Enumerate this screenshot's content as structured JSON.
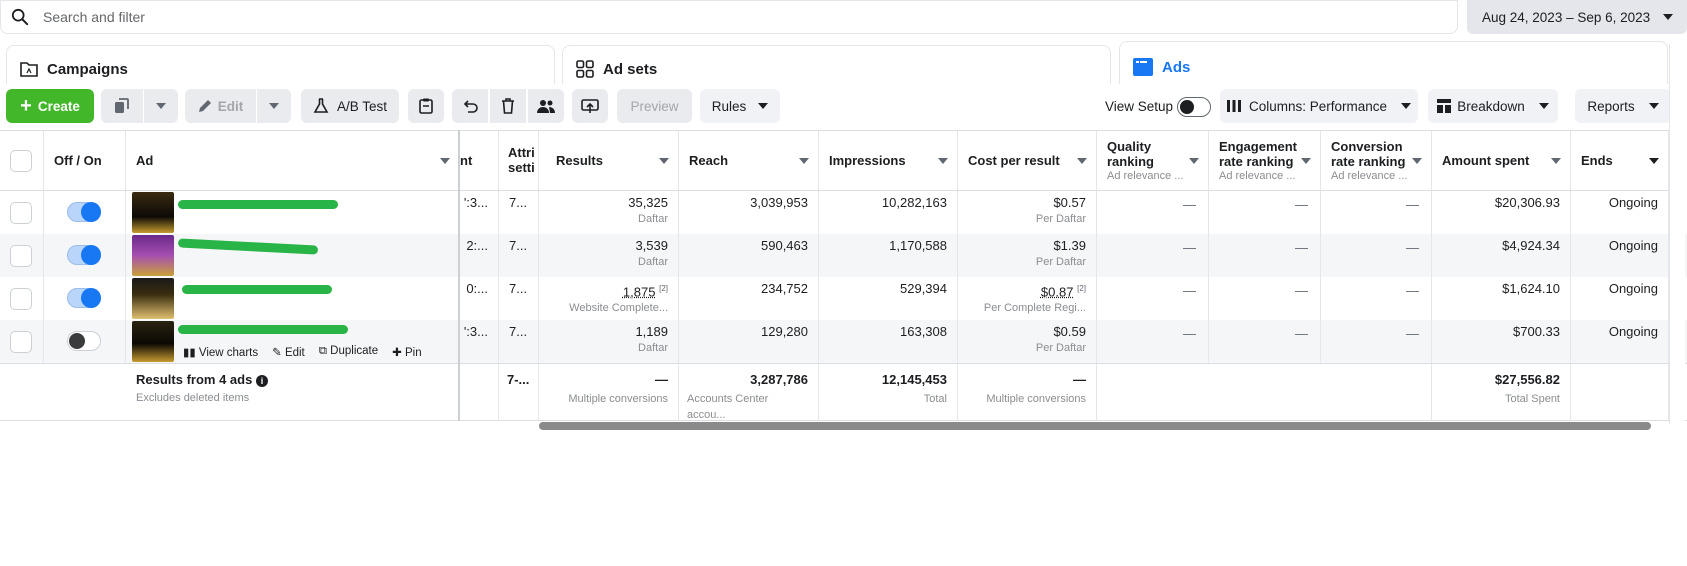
{
  "search": {
    "placeholder": "Search and filter"
  },
  "date_range": {
    "label": "Aug 24, 2023 – Sep 6, 2023"
  },
  "tabs": [
    {
      "label": "Campaigns",
      "active": false
    },
    {
      "label": "Ad sets",
      "active": false
    },
    {
      "label": "Ads",
      "active": true
    }
  ],
  "toolbar": {
    "create": "Create",
    "edit": "Edit",
    "ab_test": "A/B Test",
    "preview": "Preview",
    "rules": "Rules",
    "view_setup": "View Setup",
    "columns": "Columns: Performance",
    "breakdown": "Breakdown",
    "reports": "Reports"
  },
  "columns": {
    "off_on": "Off / On",
    "ad": "Ad",
    "partial_1": "nt",
    "attribution": [
      "Attri",
      "setti"
    ],
    "results": "Results",
    "reach": "Reach",
    "impressions": "Impressions",
    "cost_per_result": "Cost per result",
    "quality_ranking": [
      "Quality",
      "ranking"
    ],
    "quality_sub": "Ad relevance ...",
    "engagement_ranking": [
      "Engagement",
      "rate ranking"
    ],
    "engagement_sub": "Ad relevance ...",
    "conversion_ranking": [
      "Conversion",
      "rate ranking"
    ],
    "conversion_sub": "Ad relevance ...",
    "amount_spent": "Amount spent",
    "ends": "Ends"
  },
  "rows": [
    {
      "toggle_on": true,
      "partial": "':3...",
      "attr": "7...",
      "results": "35,325",
      "results_sub": "Daftar",
      "reach": "3,039,953",
      "impressions": "10,282,163",
      "cost": "$0.57",
      "cost_sub": "Per Daftar",
      "quality": "—",
      "engagement": "—",
      "conversion": "—",
      "spent": "$20,306.93",
      "ends": "Ongoing"
    },
    {
      "toggle_on": true,
      "partial": "2:...",
      "attr": "7...",
      "results": "3,539",
      "results_sub": "Daftar",
      "reach": "590,463",
      "impressions": "1,170,588",
      "cost": "$1.39",
      "cost_sub": "Per Daftar",
      "quality": "—",
      "engagement": "—",
      "conversion": "—",
      "spent": "$4,924.34",
      "ends": "Ongoing"
    },
    {
      "toggle_on": true,
      "partial": "0:...",
      "attr": "7...",
      "results": "1,875",
      "results_note": "[2]",
      "results_sub": "Website Complete...",
      "reach": "234,752",
      "impressions": "529,394",
      "cost": "$0.87",
      "cost_note": "[2]",
      "cost_sub": "Per Complete Regi...",
      "quality": "—",
      "engagement": "—",
      "conversion": "—",
      "spent": "$1,624.10",
      "ends": "Ongoing"
    },
    {
      "toggle_on": false,
      "partial": "':3...",
      "attr": "7...",
      "results": "1,189",
      "results_sub": "Daftar",
      "reach": "129,280",
      "impressions": "163,308",
      "cost": "$0.59",
      "cost_sub": "Per Daftar",
      "quality": "—",
      "engagement": "—",
      "conversion": "—",
      "spent": "$700.33",
      "ends": "Ongoing"
    }
  ],
  "row_actions": {
    "view_charts": "View charts",
    "edit": "Edit",
    "duplicate": "Duplicate",
    "pin": "Pin"
  },
  "summary": {
    "title": "Results from 4 ads",
    "subtitle": "Excludes deleted items",
    "attr": "7-...",
    "results": "—",
    "results_sub": "Multiple conversions",
    "reach": "3,287,786",
    "reach_sub": "Accounts Center accou...",
    "impressions": "12,145,453",
    "impressions_sub": "Total",
    "cost": "—",
    "cost_sub": "Multiple conversions",
    "spent": "$27,556.82",
    "spent_sub": "Total Spent"
  },
  "colors": {
    "accent": "#1877f2",
    "create_green": "#42b72a",
    "scribble": "#28b446"
  }
}
